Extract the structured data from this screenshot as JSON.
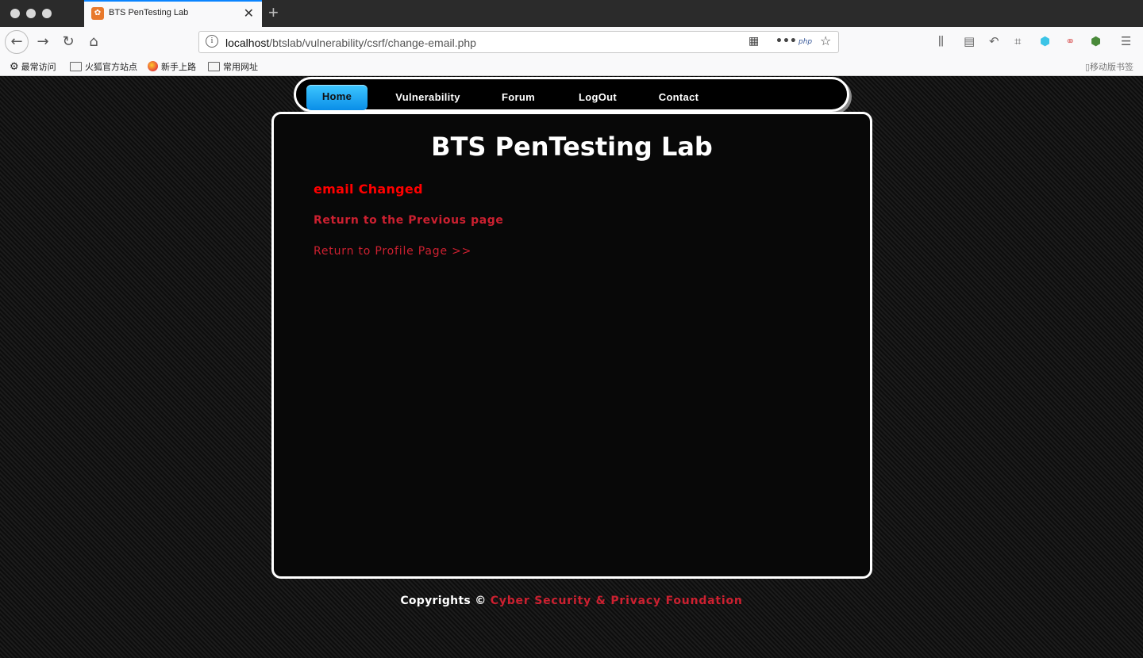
{
  "browser": {
    "tab_title": "BTS PenTesting Lab",
    "tab_close": "✕",
    "new_tab": "+",
    "url_host": "localhost",
    "url_path": "/btslab/vulnerability/csrf/change-email.php",
    "url_php_badge": "php",
    "bookmarks": [
      "最常访问",
      "火狐官方站点",
      "新手上路",
      "常用网址"
    ],
    "mobile_bookmarks": "移动版书签"
  },
  "site_nav": {
    "items": [
      "Home",
      "Vulnerability",
      "Forum",
      "LogOut",
      "Contact"
    ],
    "active": "Home"
  },
  "main": {
    "title": "BTS PenTesting Lab",
    "message": "email Changed",
    "link_previous": "Return to the Previous page",
    "link_profile": "Return to Profile Page >>"
  },
  "footer": {
    "copyright": "Copyrights ©",
    "org": "Cyber Security & Privacy Foundation"
  },
  "colors": {
    "accent_blue": "#0a84ff",
    "message_red": "#ff0000",
    "link_red": "#cc2030",
    "nav_active": "#1aa8f5"
  },
  "icons": [
    "back-arrow-icon",
    "forward-arrow-icon",
    "reload-icon",
    "home-icon",
    "info-icon",
    "qr-code-icon",
    "more-icon",
    "star-icon",
    "library-icon",
    "sidebar-icon",
    "undo-icon",
    "crop-icon",
    "menu-icon"
  ]
}
